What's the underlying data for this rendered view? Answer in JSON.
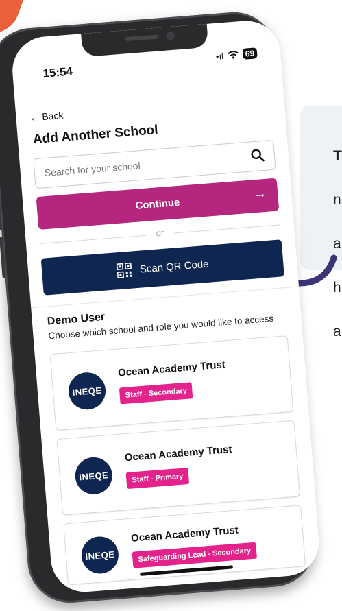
{
  "status": {
    "time": "15:54",
    "signal": "•ıl",
    "battery": "69"
  },
  "nav": {
    "back_label": "Back"
  },
  "page": {
    "title": "Add Another School"
  },
  "search": {
    "placeholder": "Search for your school",
    "value": ""
  },
  "actions": {
    "continue_label": "Continue",
    "or_label": "or",
    "scan_label": "Scan QR Code"
  },
  "demo": {
    "title": "Demo User",
    "subtitle": "Choose which school and role you would like to access",
    "schools": [
      {
        "logo": "INEQE",
        "name": "Ocean Academy Trust",
        "role": "Staff - Secondary"
      },
      {
        "logo": "INEQE",
        "name": "Ocean Academy Trust",
        "role": "Staff - Primary"
      },
      {
        "logo": "INEQE",
        "name": "Ocean Academy Trust",
        "role": "Safeguarding Lead - Secondary"
      }
    ]
  },
  "callout": {
    "lines": [
      "T",
      "n",
      "a",
      "h",
      "a"
    ]
  },
  "colors": {
    "primary": "#b5267e",
    "navy": "#0f2650",
    "badge": "#e3238b",
    "accent": "#e9603a"
  },
  "icons": {
    "search": "search-icon",
    "continue": "arrow-right-icon",
    "scan": "qr-code-icon",
    "back": "arrow-left-icon"
  }
}
